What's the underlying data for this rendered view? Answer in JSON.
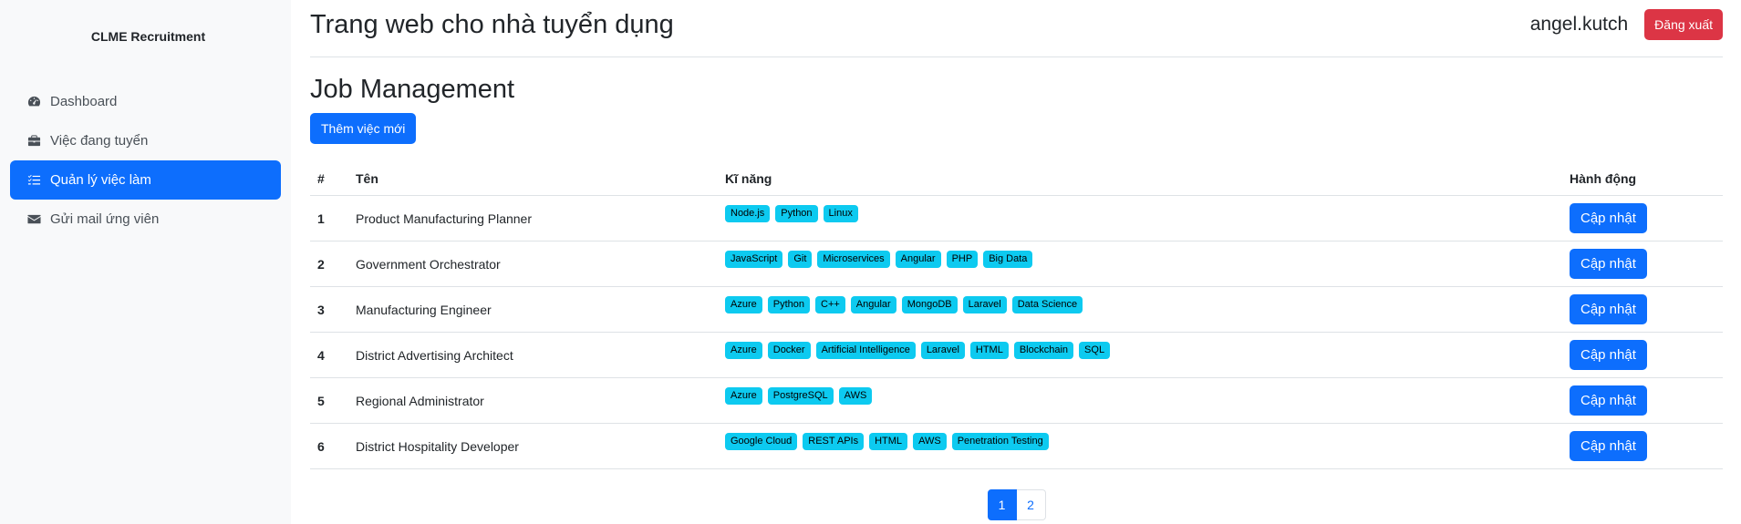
{
  "sidebar": {
    "brand": "CLME Recruitment",
    "items": [
      {
        "label": "Dashboard",
        "icon": "gauge-icon",
        "active": false
      },
      {
        "label": "Việc đang tuyển",
        "icon": "briefcase-icon",
        "active": false
      },
      {
        "label": "Quản lý việc làm",
        "icon": "list-check-icon",
        "active": true
      },
      {
        "label": "Gửi mail ứng viên",
        "icon": "envelope-icon",
        "active": false
      }
    ]
  },
  "header": {
    "title": "Trang web cho nhà tuyển dụng",
    "username": "angel.kutch",
    "logout_label": "Đăng xuất"
  },
  "main": {
    "page_title": "Job Management",
    "add_label": "Thêm việc mới",
    "columns": [
      "#",
      "Tên",
      "Kĩ năng",
      "Hành động"
    ],
    "update_label": "Cập nhật",
    "rows": [
      {
        "num": "1",
        "name": "Product Manufacturing Planner",
        "skills": [
          "Node.js",
          "Python",
          "Linux"
        ]
      },
      {
        "num": "2",
        "name": "Government Orchestrator",
        "skills": [
          "JavaScript",
          "Git",
          "Microservices",
          "Angular",
          "PHP",
          "Big Data"
        ]
      },
      {
        "num": "3",
        "name": "Manufacturing Engineer",
        "skills": [
          "Azure",
          "Python",
          "C++",
          "Angular",
          "MongoDB",
          "Laravel",
          "Data Science"
        ]
      },
      {
        "num": "4",
        "name": "District Advertising Architect",
        "skills": [
          "Azure",
          "Docker",
          "Artificial Intelligence",
          "Laravel",
          "HTML",
          "Blockchain",
          "SQL"
        ]
      },
      {
        "num": "5",
        "name": "Regional Administrator",
        "skills": [
          "Azure",
          "PostgreSQL",
          "AWS"
        ]
      },
      {
        "num": "6",
        "name": "District Hospitality Developer",
        "skills": [
          "Google Cloud",
          "REST APIs",
          "HTML",
          "AWS",
          "Penetration Testing"
        ]
      }
    ],
    "pagination": {
      "pages": [
        "1",
        "2"
      ],
      "current": "1"
    }
  },
  "colors": {
    "primary": "#0d6efd",
    "danger": "#dc3545",
    "badge": "#0dcaf0",
    "sidebar_bg": "#f8f9fa"
  }
}
